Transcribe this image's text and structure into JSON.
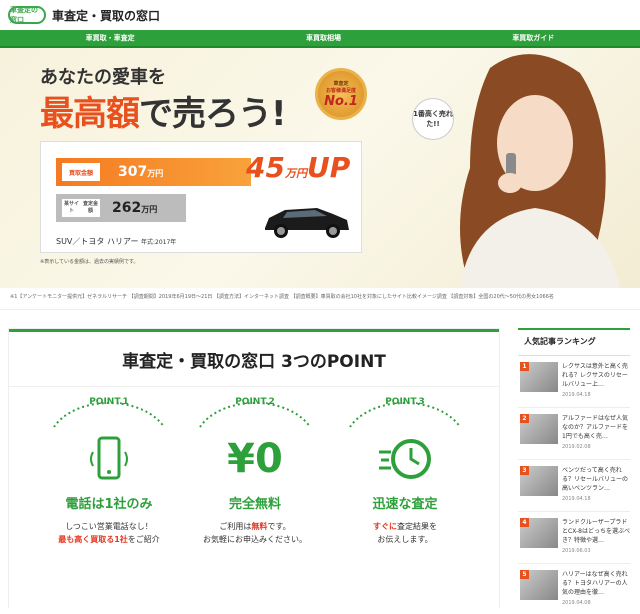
{
  "header": {
    "logo_text": "車査定の窓口",
    "title": "車査定・買取の窓口"
  },
  "nav": [
    "車買取・車査定",
    "車買取相場",
    "車買取ガイド"
  ],
  "hero": {
    "subtitle": "あなたの愛車を",
    "main_red": "最高額",
    "main_rest": "で売ろう!",
    "badge": {
      "line1": "車査定",
      "line2": "お客様満足度",
      "line3": "No.1"
    },
    "bubble": "1番高く売れた!!",
    "price_label": "買取金額",
    "price": "307",
    "price_unit": "万円",
    "other_label_1": "某サイト",
    "other_label_2": "査定金額",
    "other_price": "262",
    "other_unit": "万円",
    "up_value": "45",
    "up_unit": "万円",
    "up_text": "UP",
    "car_name": "SUV／トヨタ ハリアー",
    "car_year": "年式:2017年",
    "note": "※表示している金額は、過去の実績例です。"
  },
  "survey": "※1【アンケートモニター提供元】ゼネラルリサーチ 【調査期間】2019年6月19日〜21日 【調査方法】インターネット調査 【調査概要】車買取の会社10社を対象にしたサイト比較イメージ調査 【調査対象】全国の20代〜50代の男女1066名",
  "points": {
    "heading": "車査定・買取の窓口 3つのPOINT",
    "items": [
      {
        "label": "POINT.1",
        "icon": "phone-icon",
        "title": "電話は1社のみ",
        "desc1": "しつこい営業電話なし！",
        "desc2_red": "最も高く買取る1社",
        "desc2_rest": "をご紹介"
      },
      {
        "label": "POINT.2",
        "icon": "yen-icon",
        "title": "完全無料",
        "desc1_pre": "ご利用は",
        "desc1_red": "無料",
        "desc1_post": "です。",
        "desc2": "お気軽にお申込みください。"
      },
      {
        "label": "POINT.3",
        "icon": "speed-clock-icon",
        "title": "迅速な査定",
        "desc1_red": "すぐに",
        "desc1_post": "査定結果を",
        "desc2": "お伝えします。"
      }
    ]
  },
  "sidebar": {
    "title": "人気記事ランキング",
    "items": [
      {
        "rank": "1",
        "text": "レクサスは意外と高く売れる？レクサスのリセールバリュー上…",
        "date": "2019.04.18"
      },
      {
        "rank": "2",
        "text": "アルファードはなぜ人気なのか？アルファードを1円でも高く売…",
        "date": "2019.02.08"
      },
      {
        "rank": "3",
        "text": "ベンツだって高く売れる？リセールバリューの高いベンツラン…",
        "date": "2019.04.18"
      },
      {
        "rank": "4",
        "text": "ランドクルーザープラドとCX-8はどっちを選ぶべき？特徴や選…",
        "date": "2019.06.03"
      },
      {
        "rank": "5",
        "text": "ハリアーはなぜ高く売れる？トヨタハリアーの人気の理由を徹…",
        "date": "2019.04.08"
      }
    ]
  }
}
